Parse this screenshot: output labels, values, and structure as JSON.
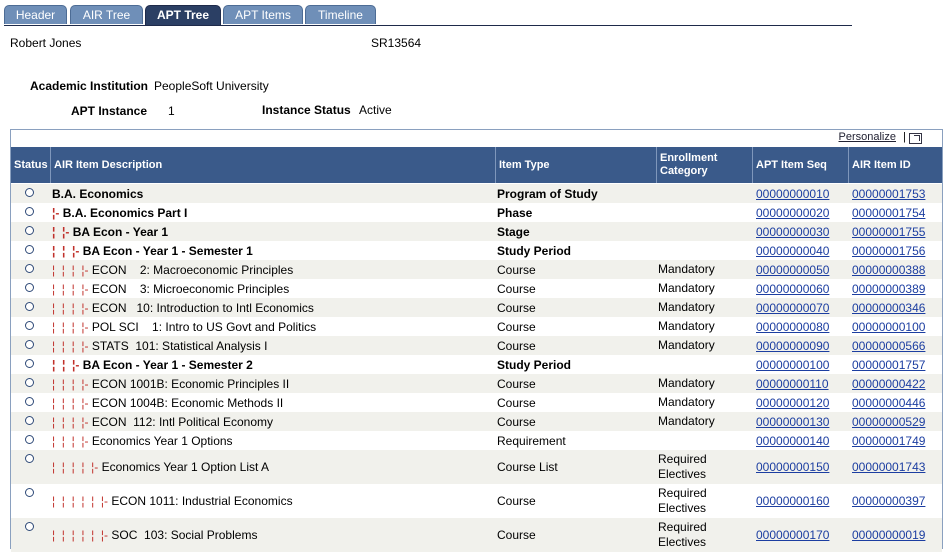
{
  "tabs": [
    "Header",
    "AIR Tree",
    "APT Tree",
    "APT Items",
    "Timeline"
  ],
  "active_tab": "APT Tree",
  "person": {
    "name": "Robert Jones",
    "id": "SR13564"
  },
  "info": {
    "institution_label": "Academic Institution",
    "institution_value": "PeopleSoft University",
    "instance_label": "APT Instance",
    "instance_value": "1",
    "status_label": "Instance Status",
    "status_value": "Active"
  },
  "grid": {
    "personalize": "Personalize",
    "pipe": "|",
    "columns": [
      "Status",
      "AIR Item Description",
      "Item Type",
      "Enrollment Category",
      "APT Item Seq",
      "AIR Item ID"
    ],
    "rows": [
      {
        "level": 0,
        "bold": true,
        "desc": "B.A. Economics",
        "type": "Program of Study",
        "cat": "",
        "seq": "00000000010",
        "id": "00000001753"
      },
      {
        "level": 1,
        "bold": true,
        "desc": "B.A. Economics Part I",
        "type": "Phase",
        "cat": "",
        "seq": "00000000020",
        "id": "00000001754"
      },
      {
        "level": 2,
        "bold": true,
        "desc": "BA Econ - Year 1",
        "type": "Stage",
        "cat": "",
        "seq": "00000000030",
        "id": "00000001755"
      },
      {
        "level": 3,
        "bold": true,
        "desc": "BA Econ - Year 1 - Semester 1",
        "type": "Study Period",
        "cat": "",
        "seq": "00000000040",
        "id": "00000001756"
      },
      {
        "level": 4,
        "bold": false,
        "desc": "ECON    2: Macroeconomic Principles",
        "type": "Course",
        "cat": "Mandatory",
        "seq": "00000000050",
        "id": "00000000388"
      },
      {
        "level": 4,
        "bold": false,
        "desc": "ECON    3: Microeconomic Principles",
        "type": "Course",
        "cat": "Mandatory",
        "seq": "00000000060",
        "id": "00000000389"
      },
      {
        "level": 4,
        "bold": false,
        "desc": "ECON   10: Introduction to Intl Economics",
        "type": "Course",
        "cat": "Mandatory",
        "seq": "00000000070",
        "id": "00000000346"
      },
      {
        "level": 4,
        "bold": false,
        "desc": "POL SCI    1: Intro to US Govt and Politics",
        "type": "Course",
        "cat": "Mandatory",
        "seq": "00000000080",
        "id": "00000000100"
      },
      {
        "level": 4,
        "bold": false,
        "desc": "STATS  101: Statistical Analysis I",
        "type": "Course",
        "cat": "Mandatory",
        "seq": "00000000090",
        "id": "00000000566"
      },
      {
        "level": 3,
        "bold": true,
        "desc": "BA Econ - Year 1 - Semester 2",
        "type": "Study Period",
        "cat": "",
        "seq": "00000000100",
        "id": "00000001757"
      },
      {
        "level": 4,
        "bold": false,
        "desc": "ECON 1001B: Economic Principles II",
        "type": "Course",
        "cat": "Mandatory",
        "seq": "00000000110",
        "id": "00000000422"
      },
      {
        "level": 4,
        "bold": false,
        "desc": "ECON 1004B: Economic Methods II",
        "type": "Course",
        "cat": "Mandatory",
        "seq": "00000000120",
        "id": "00000000446"
      },
      {
        "level": 4,
        "bold": false,
        "desc": "ECON  112: Intl Political Economy",
        "type": "Course",
        "cat": "Mandatory",
        "seq": "00000000130",
        "id": "00000000529"
      },
      {
        "level": 4,
        "bold": false,
        "desc": "Economics Year 1 Options",
        "type": "Requirement",
        "cat": "",
        "seq": "00000000140",
        "id": "00000001749"
      },
      {
        "level": 5,
        "bold": false,
        "desc": "Economics Year 1 Option List A",
        "type": "Course List",
        "cat": "Required Electives",
        "seq": "00000000150",
        "id": "00000001743"
      },
      {
        "level": 6,
        "bold": false,
        "desc": "ECON 1011: Industrial Economics",
        "type": "Course",
        "cat": "Required Electives",
        "seq": "00000000160",
        "id": "00000000397"
      },
      {
        "level": 6,
        "bold": false,
        "desc": "SOC  103: Social Problems",
        "type": "Course",
        "cat": "Required Electives",
        "seq": "00000000170",
        "id": "00000000019"
      }
    ]
  },
  "colors": {
    "header_bg": "#3a5a8a",
    "tab_bg": "#6f8fb8",
    "active_tab_bg": "#2b3f64",
    "link": "#1c3ea1",
    "tree_line": "#c0302a",
    "odd_row": "#f1f1ec"
  }
}
